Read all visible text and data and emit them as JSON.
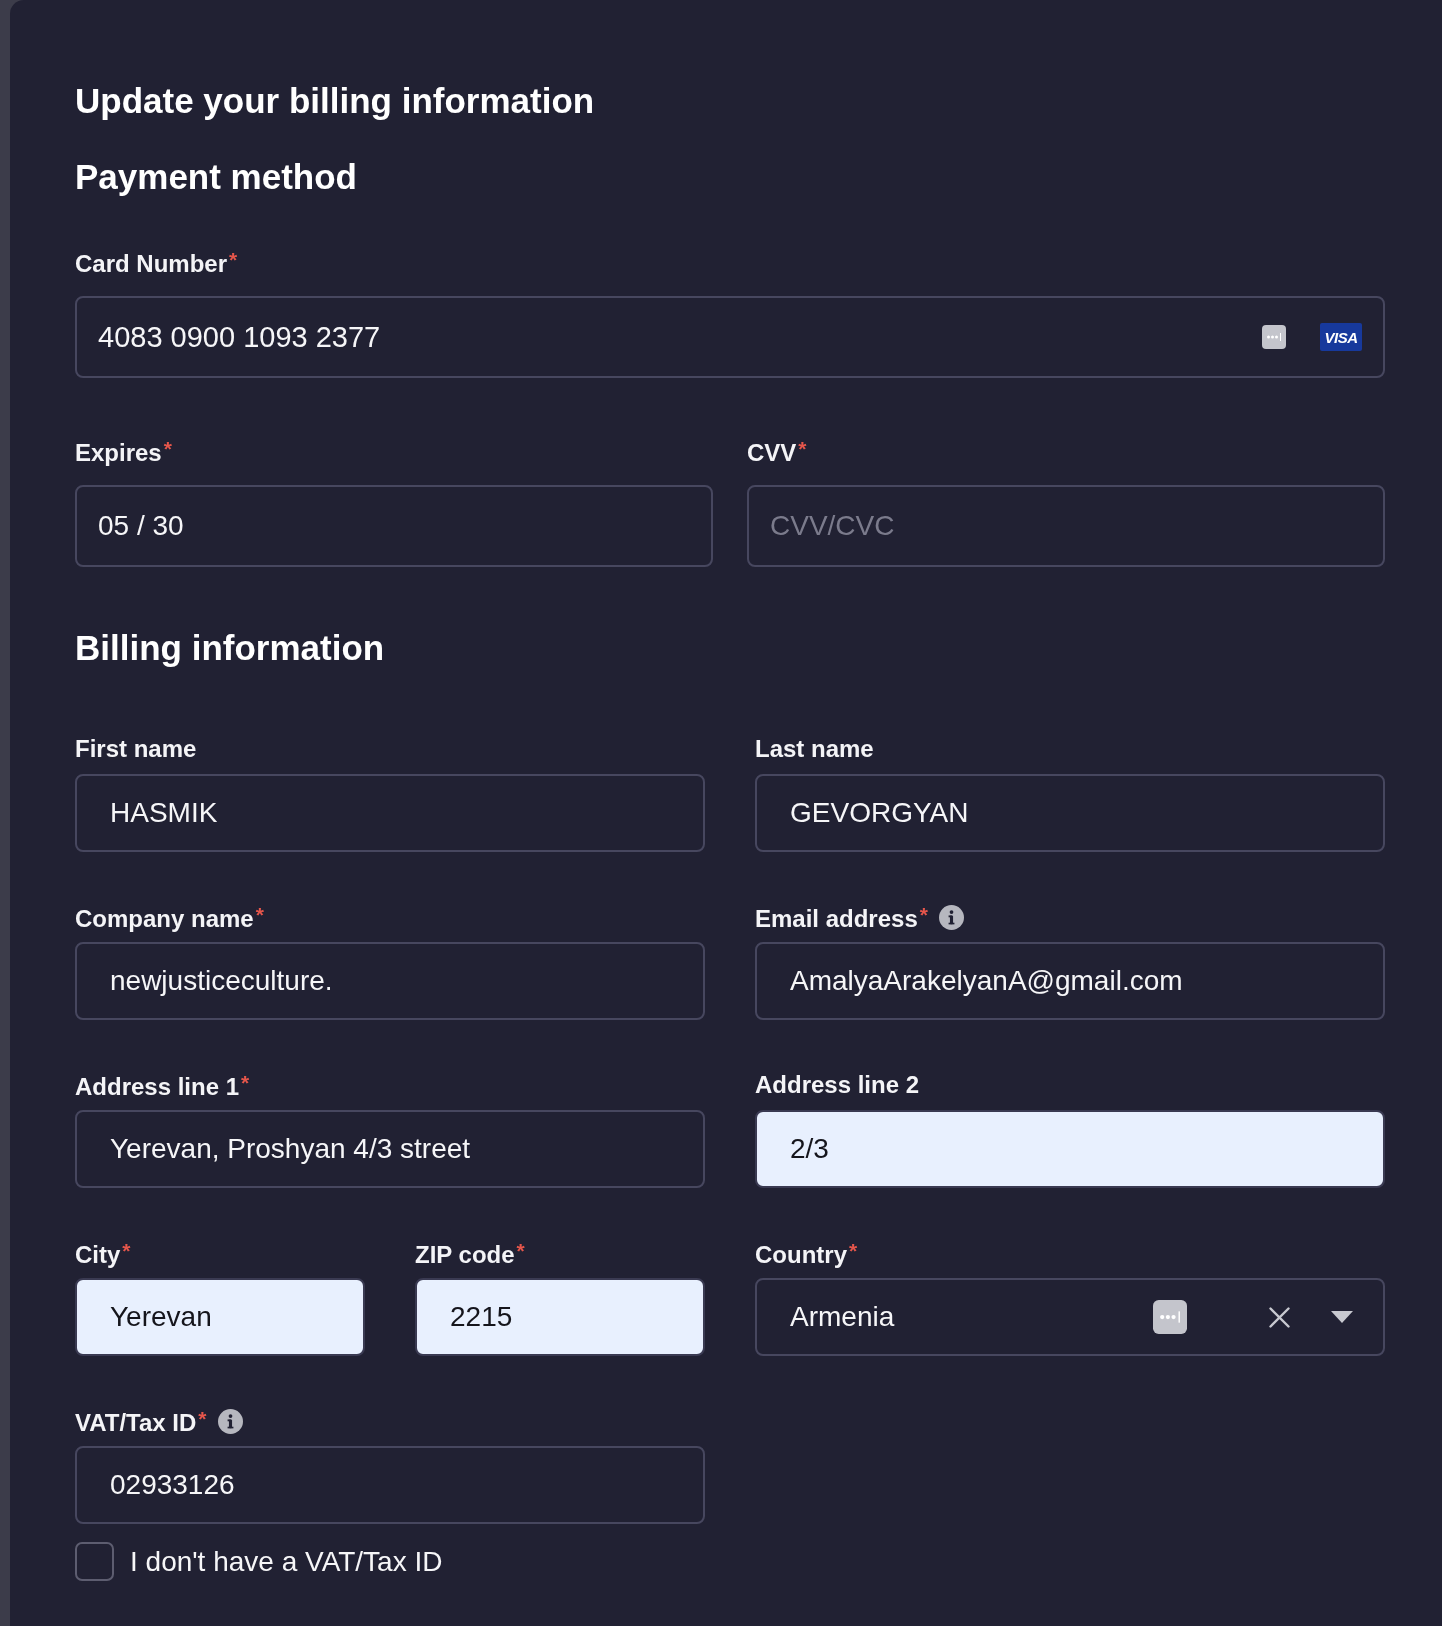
{
  "title": "Update your billing information",
  "payment_method": {
    "heading": "Payment method",
    "rows": [
      {
        "fields": [
          {
            "kind": "card",
            "label": "Card Number",
            "required_mark": "*",
            "value": "4083 0900 1093 2377",
            "card_brand": "VISA",
            "autofill_icon": true,
            "has_info": false,
            "autofilled": false
          }
        ]
      },
      {
        "fields": [
          {
            "kind": "text",
            "label": "Expires",
            "required_mark": "*",
            "value": "05 / 30",
            "autofill_icon": false,
            "has_info": false,
            "autofilled": false
          },
          {
            "kind": "text",
            "label": "CVV",
            "required_mark": "*",
            "placeholder": "CVV/CVC",
            "autofill_icon": false,
            "has_info": false,
            "autofilled": false
          }
        ]
      }
    ]
  },
  "billing_information": {
    "heading": "Billing information",
    "rows": [
      {
        "fields": [
          {
            "kind": "text",
            "label": "First name",
            "value": "HASMIK",
            "autofill_icon": false,
            "has_info": false,
            "autofilled": false
          },
          {
            "kind": "text",
            "label": "Last name",
            "value": "GEVORGYAN",
            "autofill_icon": false,
            "has_info": false,
            "autofilled": false
          }
        ]
      },
      {
        "fields": [
          {
            "kind": "text",
            "label": "Company name",
            "required_mark": "*",
            "value": "newjusticeculture.",
            "autofill_icon": false,
            "has_info": false,
            "autofilled": false
          },
          {
            "kind": "text",
            "label": "Email address",
            "required_mark": "*",
            "value": "AmalyaArakelyanA@gmail.com",
            "autofill_icon": false,
            "has_info": true,
            "autofilled": false
          }
        ]
      },
      {
        "fields": [
          {
            "kind": "text",
            "label": "Address line 1",
            "required_mark": "*",
            "value": "Yerevan, Proshyan 4/3 street",
            "autofill_icon": false,
            "has_info": false,
            "autofilled": false
          },
          {
            "kind": "text",
            "label": "Address line 2",
            "value": "2/3",
            "autofill_icon": false,
            "has_info": false,
            "autofilled": true
          }
        ]
      },
      {
        "fields": [
          {
            "kind": "text",
            "label": "City",
            "required_mark": "*",
            "value": "Yerevan",
            "autofill_icon": false,
            "has_info": false,
            "autofilled": true
          },
          {
            "kind": "text",
            "label": "ZIP code",
            "required_mark": "*",
            "value": "2215",
            "autofill_icon": false,
            "has_info": false,
            "autofilled": true
          },
          {
            "kind": "select",
            "label": "Country",
            "required_mark": "*",
            "value": "Armenia",
            "autofill_icon": true,
            "has_info": false,
            "autofilled": false
          }
        ]
      },
      {
        "fields": [
          {
            "kind": "text",
            "label": "VAT/Tax ID",
            "required_mark": "*",
            "value": "02933126",
            "autofill_icon": false,
            "has_info": true,
            "autofilled": false
          }
        ]
      }
    ],
    "checkbox": {
      "label": "I don't have a VAT/Tax ID",
      "checked": false
    }
  }
}
